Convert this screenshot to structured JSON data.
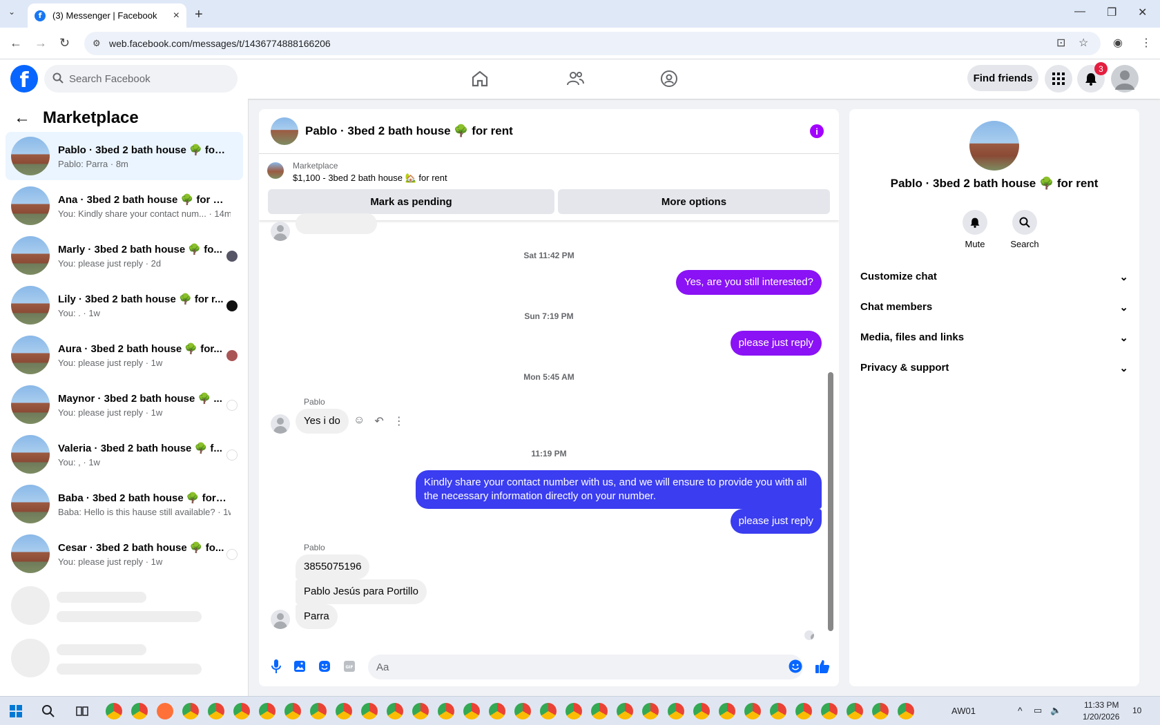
{
  "browser": {
    "tab_title": "(3) Messenger | Facebook",
    "url": "web.facebook.com/messages/t/1436774888166206"
  },
  "header": {
    "search_placeholder": "Search Facebook",
    "find_friends": "Find friends",
    "notif_count": "3"
  },
  "sidebar": {
    "title": "Marketplace",
    "items": [
      {
        "name": "Pablo · 3bed 2 bath house 🌳 for r...",
        "sub": "Pablo: Parra · 8m"
      },
      {
        "name": "Ana · 3bed 2 bath house 🌳 for rent",
        "sub": "You: Kindly share your contact num... · 14m"
      },
      {
        "name": "Marly · 3bed 2 bath house 🌳 fo...",
        "sub": "You: please just reply · 2d"
      },
      {
        "name": "Lily · 3bed 2 bath house 🌳 for r...",
        "sub": "You: . · 1w"
      },
      {
        "name": "Aura · 3bed 2 bath house 🌳 for...",
        "sub": "You: please just reply · 1w"
      },
      {
        "name": "Maynor · 3bed 2 bath house 🌳 ...",
        "sub": "You: please just reply · 1w"
      },
      {
        "name": "Valeria · 3bed 2 bath house 🌳 f...",
        "sub": "You: , · 1w"
      },
      {
        "name": "Baba · 3bed 2 bath house 🌳 for re...",
        "sub": "Baba: Hello is this hause still available? · 1w"
      },
      {
        "name": "Cesar · 3bed 2 bath house 🌳 fo...",
        "sub": "You: please just reply · 1w"
      }
    ]
  },
  "chat": {
    "title": "Pablo · 3bed 2 bath house 🌳 for rent",
    "marketplace_label": "Marketplace",
    "listing": "$1,100 - 3bed 2 bath house 🏡 for rent",
    "btn_pending": "Mark as pending",
    "btn_more": "More options",
    "ts1": "Sat 11:42 PM",
    "msg1": "Yes, are you still interested?",
    "ts2": "Sun 7:19 PM",
    "msg2": "please just reply",
    "ts3": "Mon 5:45 AM",
    "sender1": "Pablo",
    "in1": "Yes i do",
    "ts4": "11:19 PM",
    "msg3": "Kindly share your contact number with us, and we will ensure to provide you with all the necessary information directly on your number.",
    "msg4": "please just reply",
    "sender2": "Pablo",
    "in2": "3855075196",
    "in3": "Pablo Jesús para Portillo",
    "in4": "Parra",
    "composer_placeholder": "Aa"
  },
  "details": {
    "name": "Pablo · 3bed 2 bath house 🌳 for rent",
    "mute": "Mute",
    "search": "Search",
    "sections": [
      "Customize chat",
      "Chat members",
      "Media, files and links",
      "Privacy & support"
    ]
  },
  "taskbar": {
    "user": "AW01",
    "time": "11:33 PM",
    "date": "1/20/2026",
    "notif": "10"
  }
}
